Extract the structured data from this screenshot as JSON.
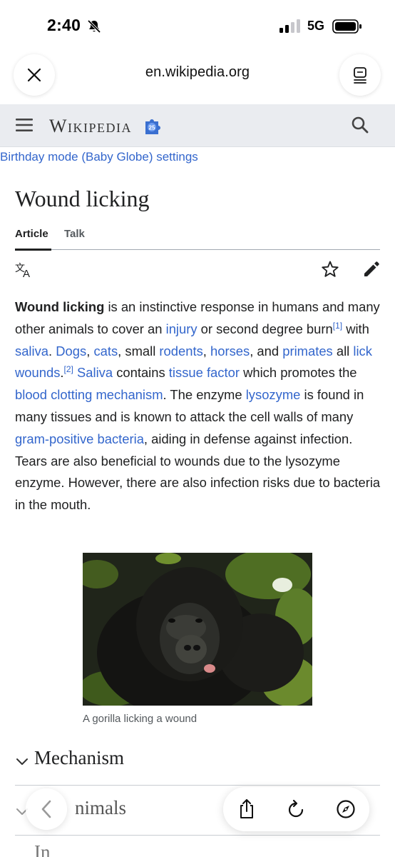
{
  "status_bar": {
    "time": "2:40",
    "network": "5G"
  },
  "browser": {
    "url": "en.wikipedia.org"
  },
  "wiki_header": {
    "wordmark": "Wikipedia",
    "globe_badge": "25"
  },
  "birthday_link": "Birthday mode (Baby Globe) settings",
  "page": {
    "title": "Wound licking",
    "tabs": [
      "Article",
      "Talk"
    ]
  },
  "article": {
    "p1": {
      "t1": "Wound licking",
      "t2": " is an instinctive response in humans and many other animals to cover an ",
      "l_injury": "injury",
      "t3": " or second degree burn",
      "ref1": "[1]",
      "t4": " with ",
      "l_saliva": "saliva",
      "t5": ". ",
      "l_dogs": "Dogs",
      "t6": ", ",
      "l_cats": "cats",
      "t7": ", small ",
      "l_rodents": "rodents",
      "t8": ", ",
      "l_horses": "horses",
      "t9": ", and ",
      "l_primates": "primates",
      "t10": " all ",
      "l_lick_wounds": "lick wounds",
      "t11": ".",
      "ref2": "[2]",
      "t12": " ",
      "l_saliva2": "Saliva",
      "t13": " contains ",
      "l_tissue_factor": "tissue factor",
      "t14": " which promotes the ",
      "l_blood_clotting": "blood clotting mechanism",
      "t15": ". The enzyme ",
      "l_lysozyme": "lysozyme",
      "t16": " is found in many tissues and is known to attack the cell walls of many ",
      "l_gram_positive": "gram-positive bacteria",
      "t17": ", aiding in defense against infection. Tears are also beneficial to wounds due to the lysozyme enzyme. However, there are also infection risks due to bacteria in the mouth."
    },
    "figure_caption": "A gorilla licking a wound"
  },
  "sections": [
    "Mechanism",
    "nimals",
    "In"
  ],
  "colors": {
    "link": "#3366cc",
    "header_bg": "#eaecf0",
    "text": "#202122"
  }
}
